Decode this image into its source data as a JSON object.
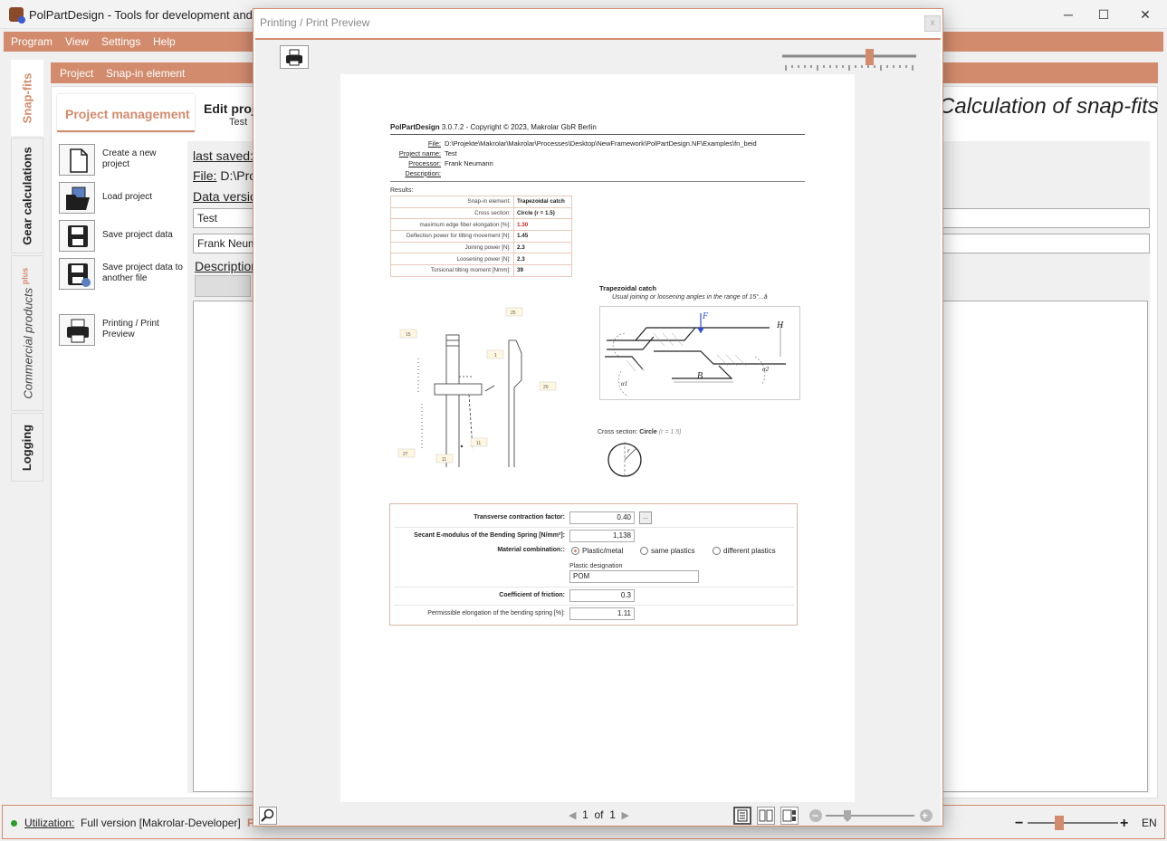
{
  "window": {
    "title": "PolPartDesign - Tools for development and des",
    "minimize_icon": "─",
    "maximize_icon": "☐",
    "close_icon": "✕"
  },
  "menu": {
    "items": [
      "Program",
      "View",
      "Settings",
      "Help"
    ]
  },
  "side_tabs": {
    "snap_fits": "Snap-fits",
    "gear": "Gear calculations",
    "commercial": "Commercial products",
    "commercial_badge": "plus",
    "logging": "Logging"
  },
  "breadcrumb": {
    "project": "Project",
    "snapin": "Snap-in element"
  },
  "main": {
    "pm_tab": "Project management",
    "edit_title": "Edit proj",
    "edit_sub": "Test",
    "calc_title": "Calculation of snap-fits",
    "actions": [
      "Create a new project",
      "Load project",
      "Save project data",
      "Save project data to another file",
      "Printing / Print Preview"
    ],
    "last_saved": "last saved:",
    "file_key": "File:",
    "file_val": "D:\\Pro",
    "data_version": "Data versic",
    "field_name": "Test",
    "field_processor": "Frank Neum",
    "description": "Description"
  },
  "status": {
    "utilization_label": "Utilization:",
    "utilization_value": "Full version [Makrolar-Developer]",
    "extra": "P",
    "lang": "EN",
    "zoom_minus": "−",
    "zoom_plus": "+"
  },
  "dialog": {
    "title": "Printing / Print Preview",
    "close": "x",
    "page": {
      "brand": "PolPartDesign",
      "header_rest": " 3.0.7.2 - Copyright © 2023, Makrolar GbR Berlin",
      "file_key": "File:",
      "file_val": "D:\\Projekte\\Makrolar\\Makrolar\\Processes\\Desktop\\NewFramework\\PolPartDesign.NF\\Examples\\fn_beid",
      "project_key": "Project name:",
      "project_val": "Test",
      "processor_key": "Processor:",
      "processor_val": "Frank Neumann",
      "description_key": "Description:",
      "results_label": "Results:",
      "results": [
        {
          "k": "Snap-in element:",
          "v": "Trapezoidal catch"
        },
        {
          "k": "Cross section:",
          "v": "Circle (r = 1.5)"
        },
        {
          "k": "maximum edge fiber elongation [%]:",
          "v": "1.30"
        },
        {
          "k": "Deflection power for tilting movement [N]:",
          "v": "1.45"
        },
        {
          "k": "Joining power [N]:",
          "v": "2.3"
        },
        {
          "k": "Loosening power [N]:",
          "v": "2.3"
        },
        {
          "k": "Torsional tilting moment [Nmm]:",
          "v": "39"
        }
      ],
      "warning_color": "#d02020",
      "dims": [
        "25",
        "15",
        "1",
        "20",
        "27",
        "11",
        "11"
      ],
      "catch_title": "Trapezoidal catch",
      "catch_sub": "Usual joining or loosening angles in the range of 15°...â",
      "catch_labels": {
        "F": "F",
        "H": "H",
        "B": "B",
        "a1": "α1",
        "a2": "α2"
      },
      "cross_prefix": "Cross section: ",
      "cross_shape": "Circle",
      "cross_detail": " (r = 1.5)",
      "cross_r": "r",
      "form": {
        "transverse_label": "Transverse contraction factor:",
        "transverse_val": "0.40",
        "ellipsis": "...",
        "secant_label": "Secant E-modulus of the Bending Spring [N/mm²]:",
        "secant_val": "1,138",
        "material_label": "Material combination::",
        "opt1": "Plastic/metal",
        "opt2": "same plastics",
        "opt3": "different plastics",
        "plastic_designation_label": "Plastic designation",
        "plastic_designation_val": "POM",
        "friction_label": "Coefficient of friction:",
        "friction_val": "0.3",
        "permissible_label": "Permissible elongation of the bending spring [%]:",
        "permissible_val": "1.11"
      }
    },
    "pager": {
      "current": "1",
      "of": "of",
      "total": "1"
    },
    "zoom_minus": "−",
    "zoom_plus": "+"
  },
  "accent_color": "#d38b6d"
}
